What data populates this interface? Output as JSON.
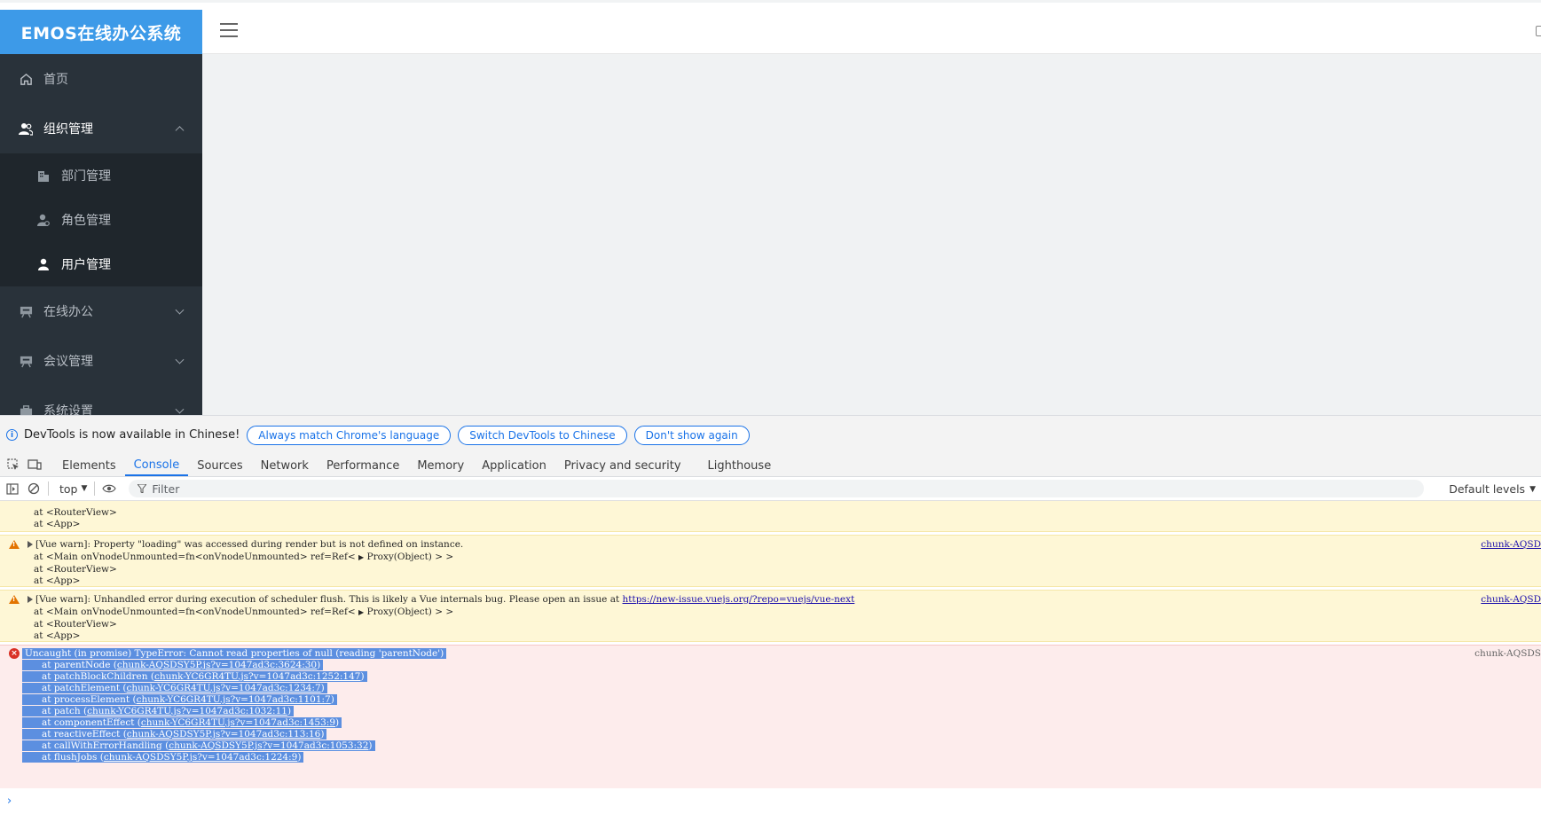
{
  "app": {
    "title": "EMOS在线办公系统"
  },
  "sidebar": {
    "items": [
      {
        "label": "首页",
        "icon": "home-icon"
      },
      {
        "label": "组织管理",
        "icon": "users-icon"
      },
      {
        "label": "部门管理",
        "icon": "building-icon"
      },
      {
        "label": "角色管理",
        "icon": "role-icon"
      },
      {
        "label": "用户管理",
        "icon": "user-icon"
      },
      {
        "label": "在线办公",
        "icon": "board-icon"
      },
      {
        "label": "会议管理",
        "icon": "meeting-icon"
      },
      {
        "label": "系统设置",
        "icon": "briefcase-icon"
      }
    ]
  },
  "devtools": {
    "notice": {
      "text": "DevTools is now available in Chinese!",
      "btn_match": "Always match Chrome's language",
      "btn_switch": "Switch DevTools to Chinese",
      "btn_dismiss": "Don't show again"
    },
    "tabs": [
      "Elements",
      "Console",
      "Sources",
      "Network",
      "Performance",
      "Memory",
      "Application",
      "Privacy and security",
      "Lighthouse"
    ],
    "toolbar": {
      "context": "top",
      "filter_placeholder": "Filter",
      "levels": "Default levels"
    },
    "console": {
      "partial_lines": [
        "at <RouterView>",
        "at <App>"
      ],
      "warn1": {
        "text": "[Vue warn]: Property \"loading\" was accessed during render but is not defined on instance.",
        "line2_pre": "at <Main onVnodeUnmounted=fn<onVnodeUnmounted> ref=Ref<",
        "line2_proxy": "Proxy(Object)",
        "line2_post": "> >",
        "line3": "at <RouterView>",
        "line4": "at <App>",
        "source": "chunk-AQSD"
      },
      "warn2": {
        "text": "[Vue warn]: Unhandled error during execution of scheduler flush. This is likely a Vue internals bug. Please open an issue at",
        "link": "https://new-issue.vuejs.org/?repo=vuejs/vue-next",
        "line2_pre": "at <Main onVnodeUnmounted=fn<onVnodeUnmounted> ref=Ref<",
        "line2_proxy": "Proxy(Object)",
        "line2_post": "> >",
        "line3": "at <RouterView>",
        "line4": "at <App>",
        "source": "chunk-AQSD"
      },
      "error": {
        "text": "Uncaught (in promise) TypeError: Cannot read properties of null (reading 'parentNode')",
        "source": "chunk-AQSDS",
        "stack": [
          {
            "fn": "at parentNode",
            "loc": "chunk-AQSDSY5P.js?v=1047ad3c:3624:30"
          },
          {
            "fn": "at patchBlockChildren",
            "loc": "chunk-YC6GR4TU.js?v=1047ad3c:1252:147"
          },
          {
            "fn": "at patchElement",
            "loc": "chunk-YC6GR4TU.js?v=1047ad3c:1234:7"
          },
          {
            "fn": "at processElement",
            "loc": "chunk-YC6GR4TU.js?v=1047ad3c:1101:7"
          },
          {
            "fn": "at patch",
            "loc": "chunk-YC6GR4TU.js?v=1047ad3c:1032:11"
          },
          {
            "fn": "at componentEffect",
            "loc": "chunk-YC6GR4TU.js?v=1047ad3c:1453:9"
          },
          {
            "fn": "at reactiveEffect",
            "loc": "chunk-AQSDSY5P.js?v=1047ad3c:113:16"
          },
          {
            "fn": "at callWithErrorHandling",
            "loc": "chunk-AQSDSY5P.js?v=1047ad3c:1053:32"
          },
          {
            "fn": "at flushJobs",
            "loc": "chunk-AQSDSY5P.js?v=1047ad3c:1224:9"
          }
        ]
      },
      "prompt": "›"
    }
  },
  "colors": {
    "logo_bg": "#3d9ae8",
    "sidebar_bg": "#29323a",
    "warn_bg": "#fef7d6",
    "error_bg": "#fdecec",
    "accent": "#1a73e8"
  }
}
